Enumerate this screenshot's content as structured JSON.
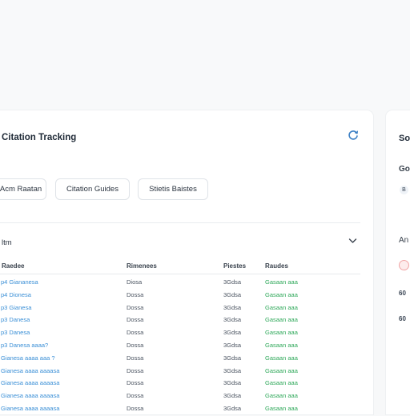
{
  "card": {
    "title": "Citation Tracking"
  },
  "filters": [
    "Acm Raatan",
    "Citation Guides",
    "Stietis Baistes"
  ],
  "section": {
    "label": "ltm"
  },
  "table": {
    "headers": [
      "Raedee",
      "Rimenees",
      "Piestes",
      "Raudes"
    ],
    "rows": [
      [
        "p4 Giananesa",
        "Diosa",
        "3Gdsa",
        "Gasaan aaa"
      ],
      [
        "p4 Dionesa",
        "Dossa",
        "3Gdsa",
        "Gasaan aaa"
      ],
      [
        "p3 Gianesa",
        "Dossa",
        "3Gdsa",
        "Gasaan aaa"
      ],
      [
        "p3 Danesa",
        "Dossa",
        "3Gdsa",
        "Gasaan aaa"
      ],
      [
        "p3 Danesa",
        "Dossa",
        "3Gdsa",
        "Gasaan aaa"
      ],
      [
        "p3 Danesa aaaa?",
        "Dossa",
        "3Gdsa",
        "Gasaan aaa"
      ],
      [
        "Gianesa aaaa aaa ?",
        "Dossa",
        "3Gdsa",
        "Gasaan aaa"
      ],
      [
        "Gianesa aaaa aaaasa",
        "Dossa",
        "3Gdsa",
        "Gasaan aaa"
      ],
      [
        "Gianesa aaaa aaaasa",
        "Dossa",
        "3Gdsa",
        "Gasaan aaa"
      ],
      [
        "Gianesa aaaa aaaasa",
        "Dossa",
        "3Gdsa",
        "Gasaan aaa"
      ],
      [
        "Gianesa aaaa aaaasa",
        "Dossa",
        "3Gdsa",
        "Gasaan aaa"
      ]
    ]
  },
  "side": {
    "title": "So",
    "sub": "Go",
    "badge": "B",
    "sub2": "An",
    "line1": "60",
    "line2": "60"
  },
  "colors": {
    "link": "#3a8fd6",
    "status_green": "#2fa85a",
    "accent_icon": "#3b7fc4"
  },
  "icons": {
    "refresh": "refresh-icon",
    "collapse": "chevron-down-icon"
  }
}
